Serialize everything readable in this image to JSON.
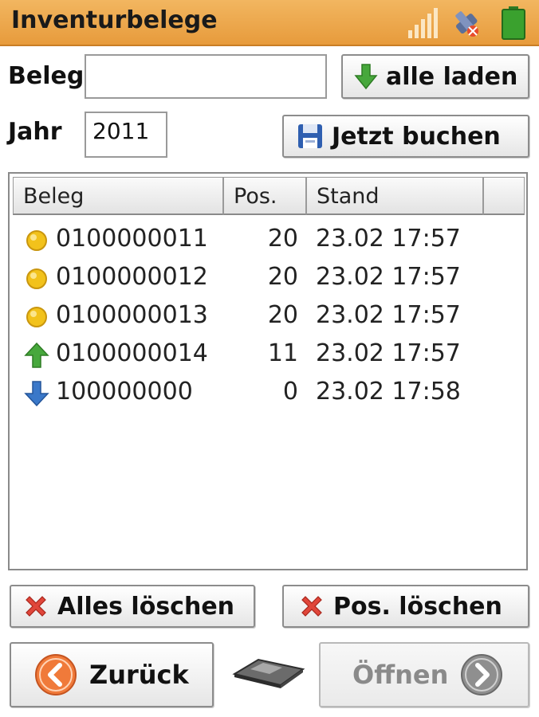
{
  "header": {
    "title": "Inventurbelege",
    "icons": [
      "signal-icon",
      "gps-icon",
      "battery-icon"
    ]
  },
  "form": {
    "beleg_label": "Beleg",
    "beleg_value": "",
    "jahr_label": "Jahr",
    "jahr_value": "2011",
    "load_all_label": "alle laden",
    "book_now_label": "Jetzt buchen"
  },
  "table": {
    "columns": [
      "Beleg",
      "Pos.",
      "Stand"
    ],
    "rows": [
      {
        "status_icon": "pending-dot-icon",
        "beleg": "0100000011",
        "pos": "20",
        "stand": "23.02 17:57"
      },
      {
        "status_icon": "pending-dot-icon",
        "beleg": "0100000012",
        "pos": "20",
        "stand": "23.02 17:57"
      },
      {
        "status_icon": "pending-dot-icon",
        "beleg": "0100000013",
        "pos": "20",
        "stand": "23.02 17:57"
      },
      {
        "status_icon": "upload-arrow-icon",
        "beleg": "0100000014",
        "pos": "11",
        "stand": "23.02 17:57"
      },
      {
        "status_icon": "download-arrow-icon",
        "beleg": "100000000",
        "pos": "0",
        "stand": "23.02 17:58"
      }
    ]
  },
  "actions": {
    "delete_all_label": "Alles löschen",
    "delete_pos_label": "Pos. löschen",
    "back_label": "Zurück",
    "open_label": "Öffnen"
  },
  "colors": {
    "titlebar": "#e9a24a",
    "pending": "#f2c21b",
    "upload": "#3fa33a",
    "download": "#3a78c9",
    "delete": "#e0463a",
    "back": "#f07a3a"
  }
}
